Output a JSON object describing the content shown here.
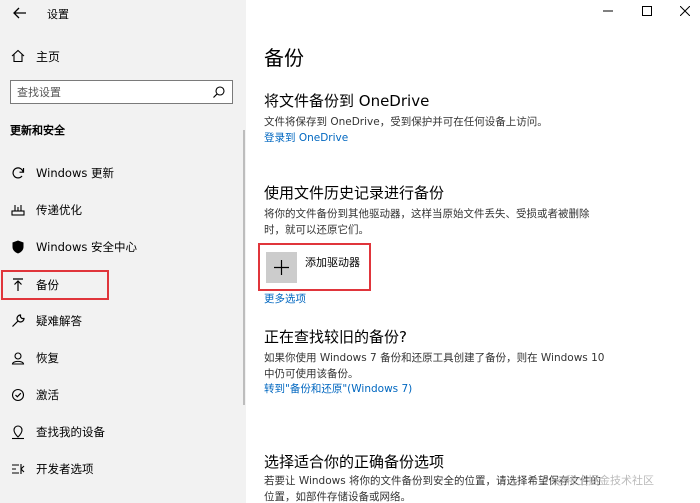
{
  "window": {
    "title": "设置",
    "controls": {
      "minimize": "—",
      "maximize": "☐",
      "close": "✕"
    }
  },
  "sidebar": {
    "home_label": "主页",
    "search_placeholder": "查找设置",
    "section_heading": "更新和安全",
    "items": [
      {
        "label": "Windows 更新",
        "icon": "refresh-icon"
      },
      {
        "label": "传递优化",
        "icon": "delivery-optimization-icon"
      },
      {
        "label": "Windows 安全中心",
        "icon": "shield-icon"
      },
      {
        "label": "备份",
        "icon": "backup-arrow-icon",
        "selected": true
      },
      {
        "label": "疑难解答",
        "icon": "wrench-icon"
      },
      {
        "label": "恢复",
        "icon": "recovery-icon"
      },
      {
        "label": "激活",
        "icon": "activation-icon"
      },
      {
        "label": "查找我的设备",
        "icon": "find-device-icon"
      },
      {
        "label": "开发者选项",
        "icon": "developer-icon"
      }
    ]
  },
  "main": {
    "title": "备份",
    "onedrive": {
      "heading": "将文件备份到 OneDrive",
      "description": "文件将保存到 OneDrive，受到保护并可在任何设备上访问。",
      "link": "登录到 OneDrive"
    },
    "file_history": {
      "heading": "使用文件历史记录进行备份",
      "description": "将你的文件备份到其他驱动器，这样当原始文件丢失、受损或者被删除时，就可以还原它们。",
      "add_drive_label": "添加驱动器",
      "more_options": "更多选项"
    },
    "older_backup": {
      "heading": "正在查找较旧的备份?",
      "description": "如果你使用 Windows 7 备份和还原工具创建了备份，则在 Windows 10 中仍可使用该备份。",
      "link": "转到\"备份和还原\"(Windows 7)"
    },
    "right_option": {
      "heading": "选择适合你的正确备份选项",
      "description": "若要让 Windows 将你的文件备份到安全的位置，请选择希望保存文件的位置，如部件存储设备或网络。"
    }
  },
  "watermark": "@稀土掘金技术社区",
  "colors": {
    "sidebar_bg": "#f2f2f2",
    "highlight_border": "#e0353b",
    "link": "#0067c0"
  }
}
